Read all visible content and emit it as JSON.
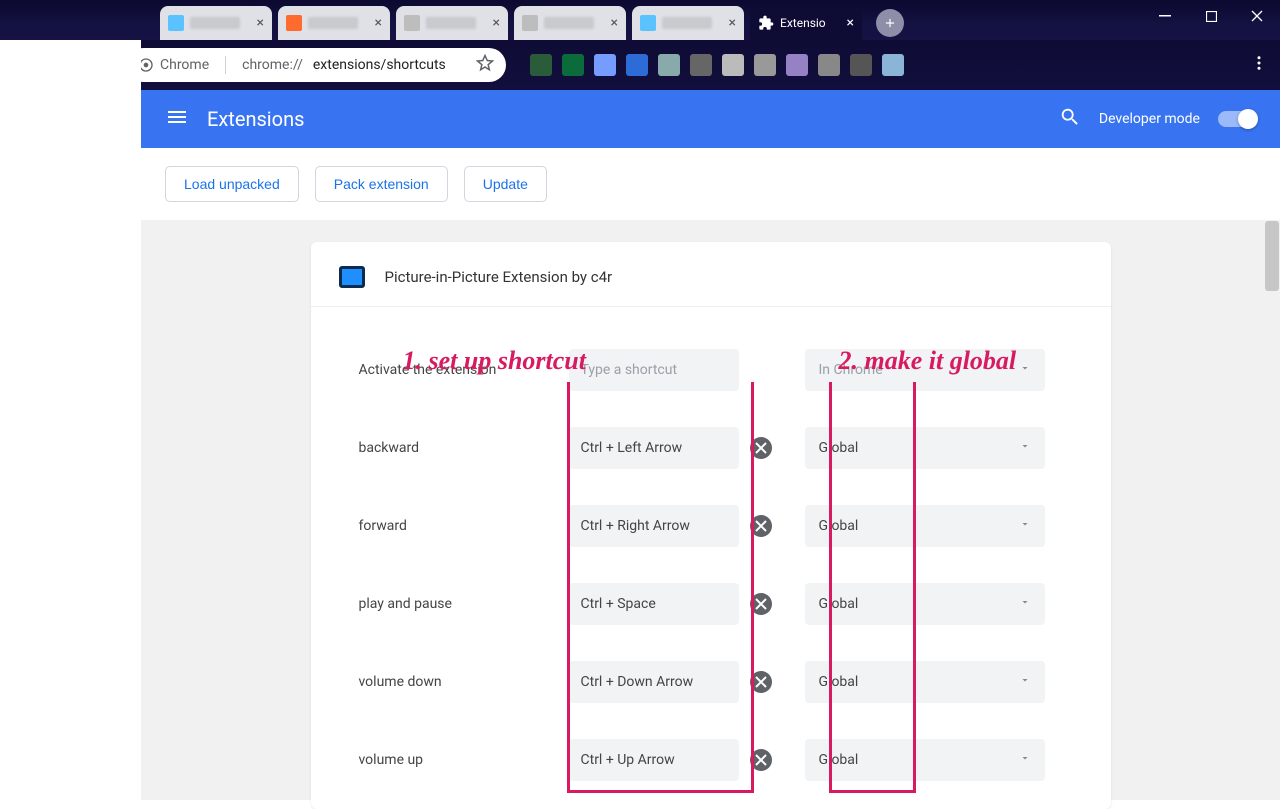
{
  "window": {
    "active_tab_label": "Extensio"
  },
  "addressbar": {
    "chip_label": "Chrome",
    "url_prefix": "chrome://",
    "url_path": "extensions/shortcuts"
  },
  "header": {
    "title": "Extensions",
    "dev_mode_label": "Developer mode"
  },
  "actions": {
    "load": "Load unpacked",
    "pack": "Pack extension",
    "update": "Update"
  },
  "card": {
    "title": "Picture-in-Picture Extension by c4r",
    "placeholder": "Type a shortcut",
    "scope_default_disabled": "In Chrome",
    "rows": [
      {
        "label": "Activate the extension",
        "shortcut": "",
        "scope": "In Chrome",
        "has_clear": false,
        "disabled_scope": true
      },
      {
        "label": "backward",
        "shortcut": "Ctrl + Left Arrow",
        "scope": "Global",
        "has_clear": true,
        "disabled_scope": false
      },
      {
        "label": "forward",
        "shortcut": "Ctrl + Right Arrow",
        "scope": "Global",
        "has_clear": true,
        "disabled_scope": false
      },
      {
        "label": "play and pause",
        "shortcut": "Ctrl + Space",
        "scope": "Global",
        "has_clear": true,
        "disabled_scope": false
      },
      {
        "label": "volume down",
        "shortcut": "Ctrl + Down Arrow",
        "scope": "Global",
        "has_clear": true,
        "disabled_scope": false
      },
      {
        "label": "volume up",
        "shortcut": "Ctrl + Up Arrow",
        "scope": "Global",
        "has_clear": true,
        "disabled_scope": false
      }
    ]
  },
  "annotations": {
    "a1": "1. set up shortcut",
    "a2": "2. make it global"
  }
}
